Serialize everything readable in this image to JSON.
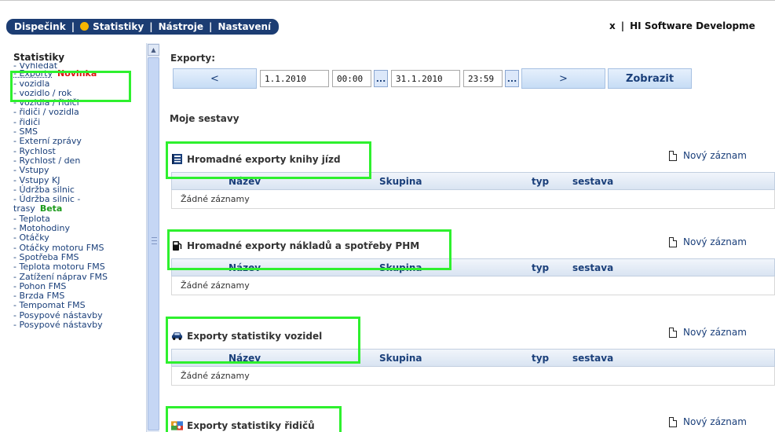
{
  "nav": {
    "items": [
      "Dispečink",
      "Statistiky",
      "Nástroje",
      "Nastavení"
    ],
    "separator": "|"
  },
  "toolbar_right": {
    "close": "x",
    "separator": "|",
    "company": "HI Software Developme"
  },
  "sidebar": {
    "title": "Statistiky",
    "items": [
      {
        "label": "- Vyhledat"
      },
      {
        "label": "- Exporty",
        "badge": "Novinka"
      },
      {
        "label": "- vozidla"
      },
      {
        "label": "- vozidlo / rok"
      },
      {
        "label": "- vozidla / řidiči"
      },
      {
        "label": "- řidiči / vozidla"
      },
      {
        "label": "- řidiči"
      },
      {
        "label": "- SMS"
      },
      {
        "label": "- Externí zprávy"
      },
      {
        "label": "- Rychlost"
      },
      {
        "label": "- Rychlost / den"
      },
      {
        "label": "- Vstupy"
      },
      {
        "label": "- Vstupy KJ"
      },
      {
        "label": "- Údržba silnic"
      },
      {
        "label": "- Údržba silnic -"
      },
      {
        "label": "trasy",
        "badge": "Beta"
      },
      {
        "label": "- Teplota"
      },
      {
        "label": "- Motohodiny"
      },
      {
        "label": "- Otáčky"
      },
      {
        "label": "- Otáčky motoru FMS"
      },
      {
        "label": "- Spotřeba FMS"
      },
      {
        "label": "- Teplota motoru FMS"
      },
      {
        "label": "- Zatížení náprav FMS"
      },
      {
        "label": "- Pohon FMS"
      },
      {
        "label": "- Brzda FMS"
      },
      {
        "label": "- Tempomat FMS"
      },
      {
        "label": "- Posypové nástavby"
      },
      {
        "label": "- Posypové nástavby"
      }
    ]
  },
  "exports": {
    "label": "Exporty:",
    "prev": "<",
    "next": ">",
    "date_from": "1.1.2010",
    "time_from": "00:00",
    "date_to": "31.1.2010",
    "time_to": "23:59",
    "picker": "...",
    "show_button": "Zobrazit"
  },
  "reports": {
    "title": "Moje sestavy",
    "new_record": "Nový záznam",
    "columns": [
      "Název",
      "Skupina",
      "typ",
      "sestava"
    ],
    "empty": "Žádné záznamy",
    "sections": [
      {
        "title": "Hromadné exporty knihy jízd",
        "icon": "book-icon"
      },
      {
        "title": "Hromadné exporty nákladů a spotřeby PHM",
        "icon": "fuel-pump-icon"
      },
      {
        "title": "Exporty statistiky vozidel",
        "icon": "car-icon"
      },
      {
        "title": "Exporty statistiky řidičů",
        "icon": "drivers-icon"
      }
    ]
  },
  "colors": {
    "nav_bg": "#1c3d73",
    "highlight": "#2ef02e",
    "badge_new": "#e01010",
    "badge_beta": "#1c9b1c"
  }
}
